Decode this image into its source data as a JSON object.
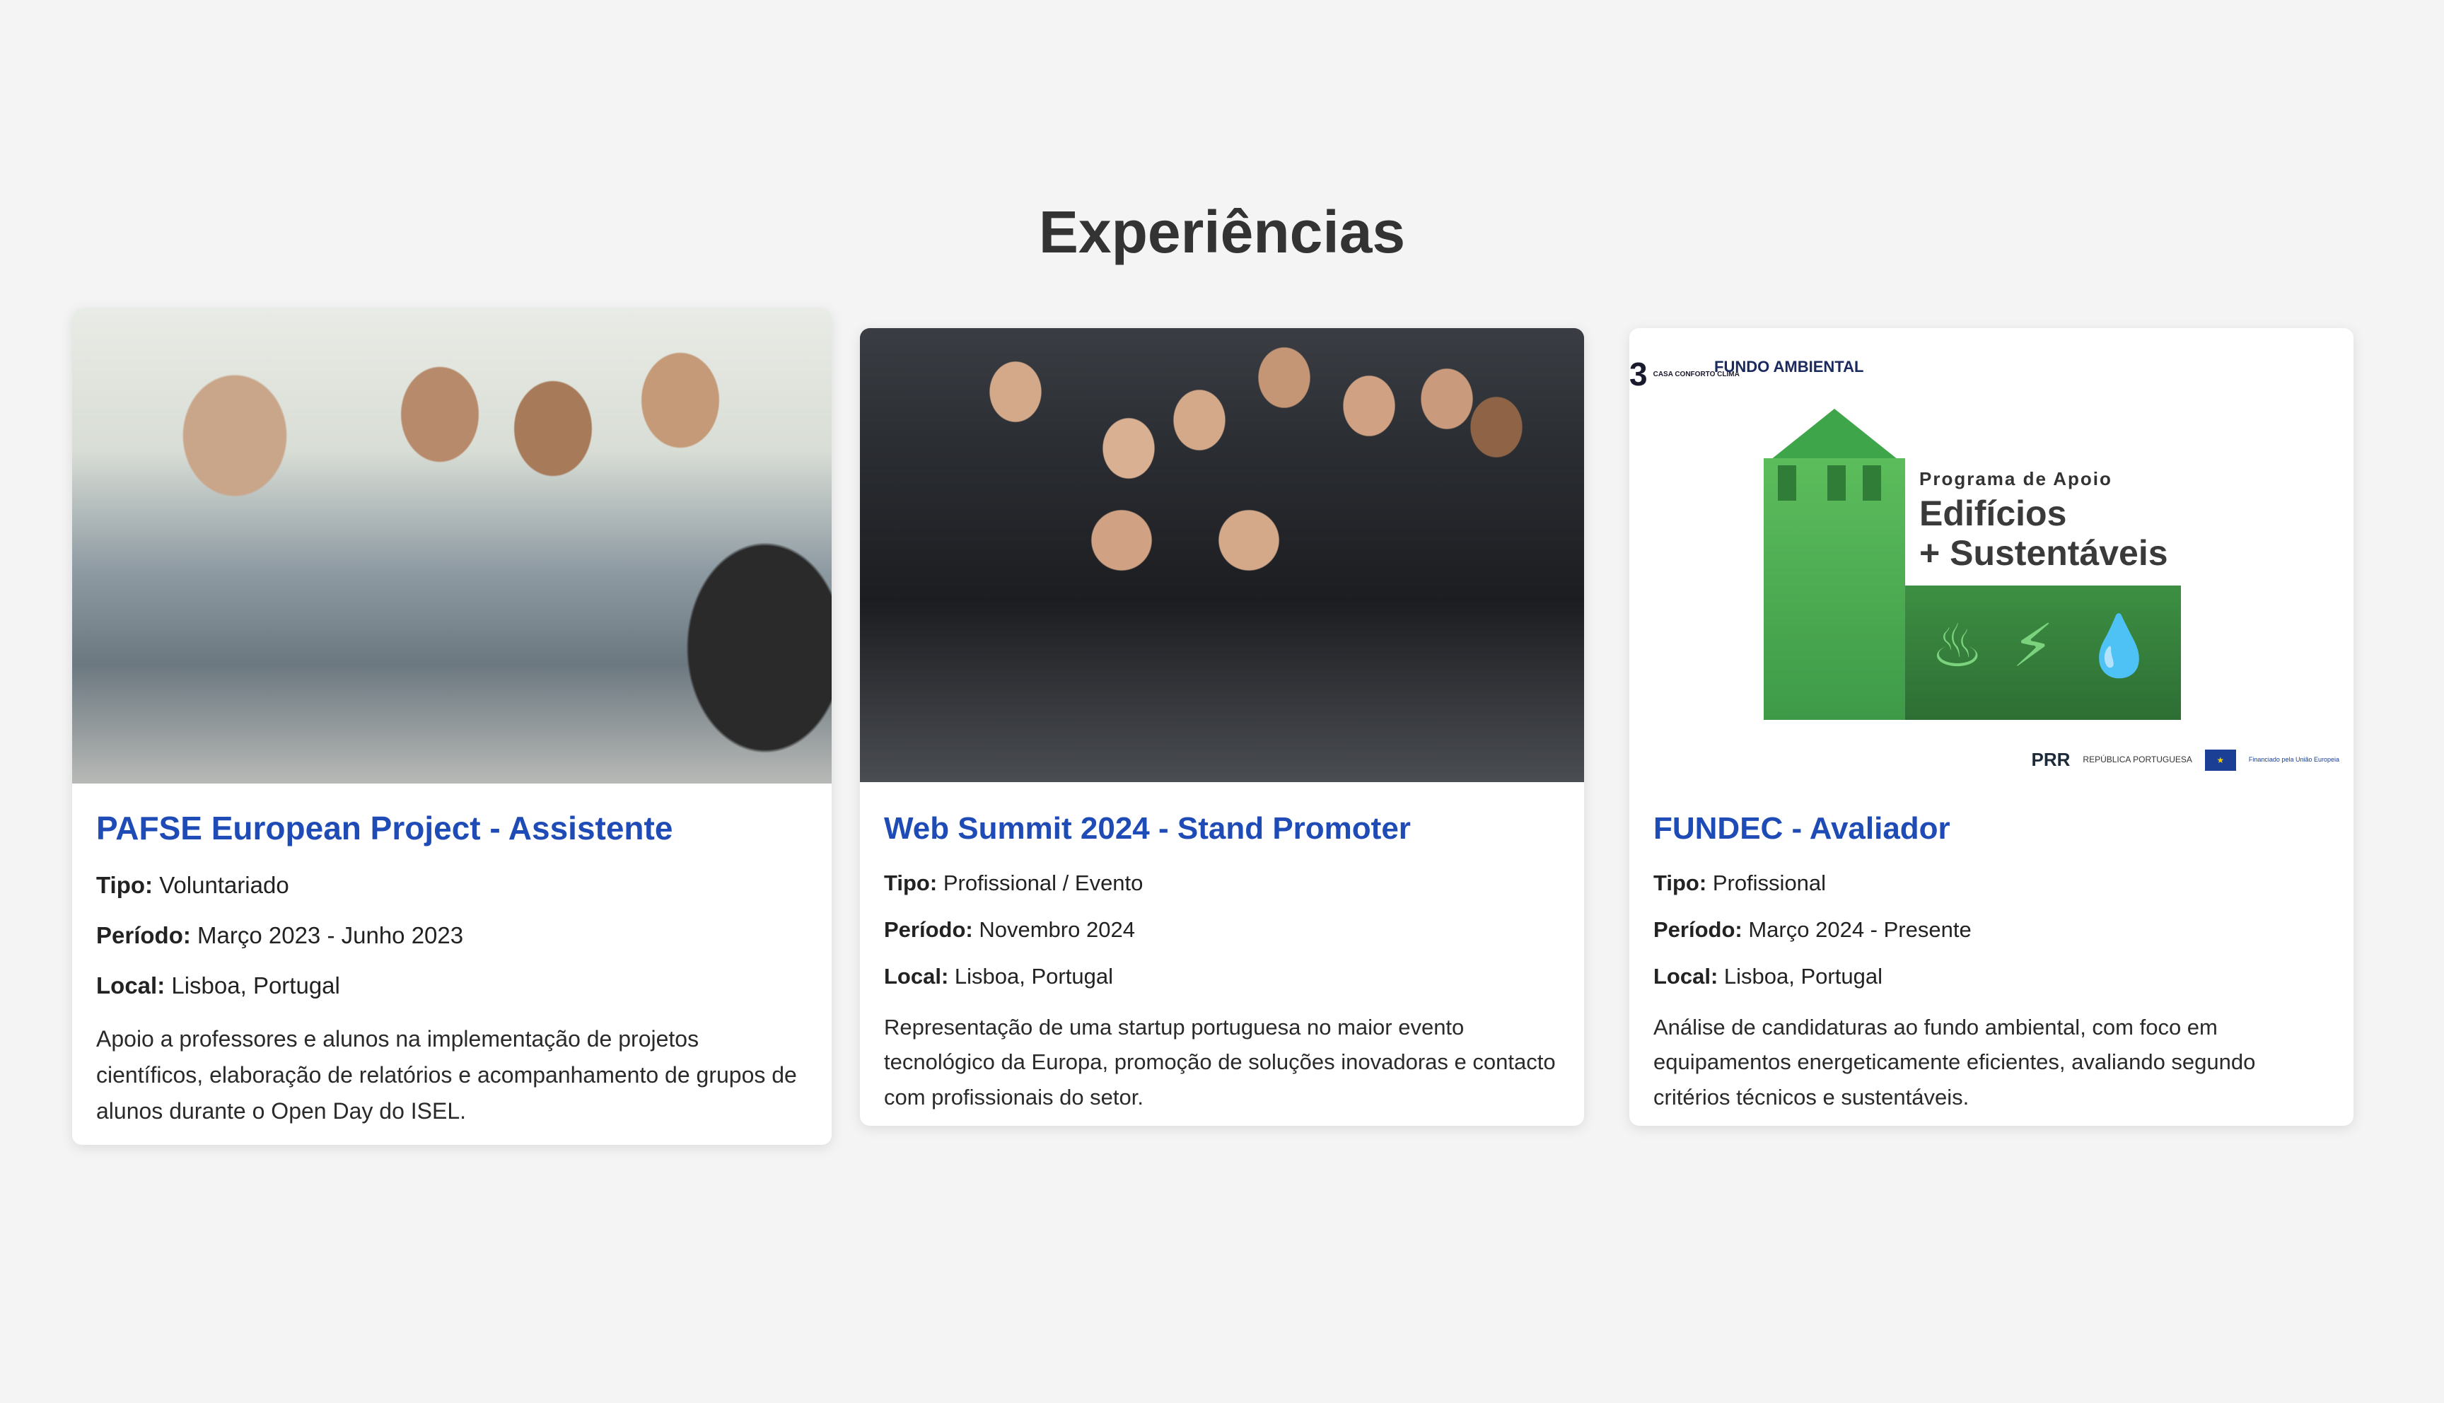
{
  "section": {
    "title": "Experiências"
  },
  "cards": [
    {
      "title": "PAFSE European Project - Assistente",
      "type_label": "Tipo:",
      "type_value": "Voluntariado",
      "period_label": "Período:",
      "period_value": "Março 2023 - Junho 2023",
      "location_label": "Local:",
      "location_value": "Lisboa, Portugal",
      "description": "Apoio a professores e alunos na implementação de projetos científicos, elaboração de relatórios e acompanhamento de grupos de alunos durante o Open Day do ISEL."
    },
    {
      "title": "Web Summit 2024 - Stand Promoter",
      "type_label": "Tipo:",
      "type_value": "Profissional / Evento",
      "period_label": "Período:",
      "period_value": "Novembro 2024",
      "location_label": "Local:",
      "location_value": "Lisboa, Portugal",
      "description": "Representação de uma startup portuguesa no maior evento tecnológico da Europa, promoção de soluções inovadoras e contacto com profissionais do setor."
    },
    {
      "title": "FUNDEC - Avaliador",
      "type_label": "Tipo:",
      "type_value": "Profissional",
      "period_label": "Período:",
      "period_value": "Março 2024 - Presente",
      "location_label": "Local:",
      "location_value": "Lisboa, Portugal",
      "description": "Análise de candidaturas ao fundo ambiental, com foco em equipamentos energeticamente eficientes, avaliando segundo critérios técnicos e sustentáveis.",
      "image_text": {
        "brand_number": "3",
        "brand_casa": "CASA CONFORTO CLIMA",
        "brand_fundo": "FUNDO AMBIENTAL",
        "program_label": "Programa de Apoio",
        "program_title_line1": "Edifícios",
        "program_title_line2": "+ Sustentáveis",
        "funder_prr": "PRR",
        "funder_republica": "REPÚBLICA PORTUGUESA",
        "funder_eu": "Financiado pela União Europeia"
      }
    }
  ],
  "colors": {
    "background": "#f4f4f4",
    "card_title": "#1e4bb5",
    "heading": "#333333",
    "logo_green": "#3fa54a"
  }
}
